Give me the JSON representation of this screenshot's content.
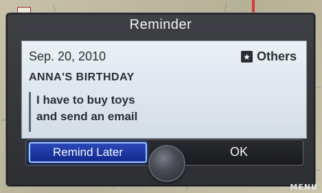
{
  "dialog": {
    "title": "Reminder",
    "date": "Sep. 20, 2010",
    "category": {
      "icon": "star-icon",
      "label": "Others"
    },
    "event_title": "ANNA'S BIRTHDAY",
    "note_lines": [
      "I have to buy toys",
      "and send an email"
    ]
  },
  "buttons": {
    "remind_later": "Remind Later",
    "ok": "OK"
  },
  "screen": {
    "menu_label": "MENU"
  },
  "colors": {
    "selected_button": "#1a36a3",
    "selected_border": "#9ec7ff",
    "dialog_background": "#36373c",
    "content_background": "#e2e8f0",
    "map_route_red": "#d43a3a"
  }
}
